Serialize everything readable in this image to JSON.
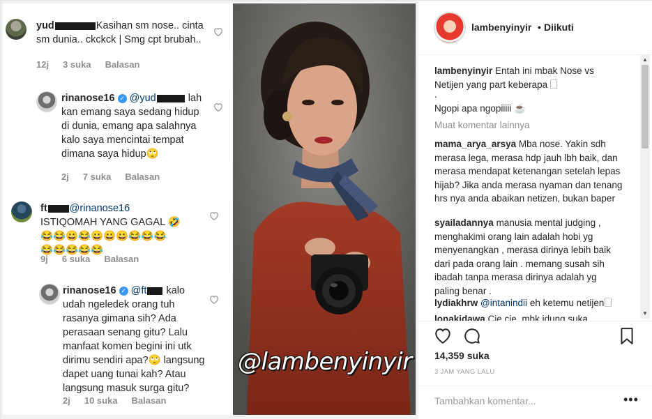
{
  "post_image": {
    "comments": [
      {
        "username": "yud",
        "text": "Kasihan sm nose.. cinta sm dunia.. ckckck | Smg cpt brubah..",
        "time": "12j",
        "likes": "3 suka",
        "reply_label": "Balasan"
      },
      {
        "username": "rinanose16",
        "mention": "@yud",
        "text": "lah kan emang saya sedang hidup di dunia, emang apa salahnya kalo saya mencintai tempat dimana saya hidup🙄",
        "time": "2j",
        "likes": "7 suka",
        "reply_label": "Balasan"
      },
      {
        "username": "ft",
        "mention": "@rinanose16",
        "text": "ISTIQOMAH YANG GAGAL 🤣",
        "emoji_line1": "😂😂😀😂😀😀😀😂😂😂",
        "emoji_line2": "😂😂😂😂😂",
        "time": "9j",
        "likes": "6 suka",
        "reply_label": "Balasan"
      },
      {
        "username": "rinanose16",
        "mention": "@ft",
        "text": "kalo udah ngeledek orang tuh rasanya gimana sih? Ada perasaan senang gitu? Lalu manfaat komen begini ini utk dirimu sendiri apa?🙄 langsung dapet uang tunai kah? Atau langsung masuk surga gitu?",
        "time": "2j",
        "likes": "10 suka",
        "reply_label": "Balasan"
      }
    ],
    "watermark": "@lambenyinyir"
  },
  "sidebar": {
    "header": {
      "username": "lambenyinyir",
      "separator": "•",
      "follow_status": "Diikuti"
    },
    "caption": {
      "username": "lambenyinyir",
      "text": "Entah ini mbak Nose vs Netijen yang part keberapa 🗌",
      "line2": ".",
      "line3": "Ngopi apa ngopiiiii ☕"
    },
    "more_comments_label": "Muat komentar lainnya",
    "comments": [
      {
        "username": "mama_arya_arsya",
        "text": "Mba nose. Yakin sdh merasa lega, merasa hdp jauh lbh baik, dan merasa mendapat ketenangan setelah lepas hijab? Jika anda merasa nyaman dan tenang hrs nya anda abaikan netizen, bukan baper"
      },
      {
        "username": "syailadannya",
        "text": "manusia mental judging , menghakimi orang lain adalah hobi yg menyenangkan , merasa dirinya lebih baik dari pada orang lain . memang susah sih ibadah tanpa merasa dirinya adalah yg paling benar ."
      },
      {
        "username": "lydiakhrw",
        "mention": "@intanindii",
        "text": "eh ketemu netijen🗌"
      },
      {
        "username": "lonakidawa",
        "text": "Cie cie..mbk idung suka"
      }
    ],
    "likes": "14,359 suka",
    "timestamp": "3 JAM YANG LALU",
    "add_comment_placeholder": "Tambahkan komentar...",
    "more_options": "•••"
  },
  "colors": {
    "text": "#262626",
    "muted": "#8e8e8e",
    "mention": "#003569",
    "verified": "#3897f0",
    "border": "#efefef"
  },
  "icons": [
    "heart-icon",
    "comment-icon",
    "bookmark-icon",
    "more-options-icon",
    "verified-badge-icon"
  ]
}
